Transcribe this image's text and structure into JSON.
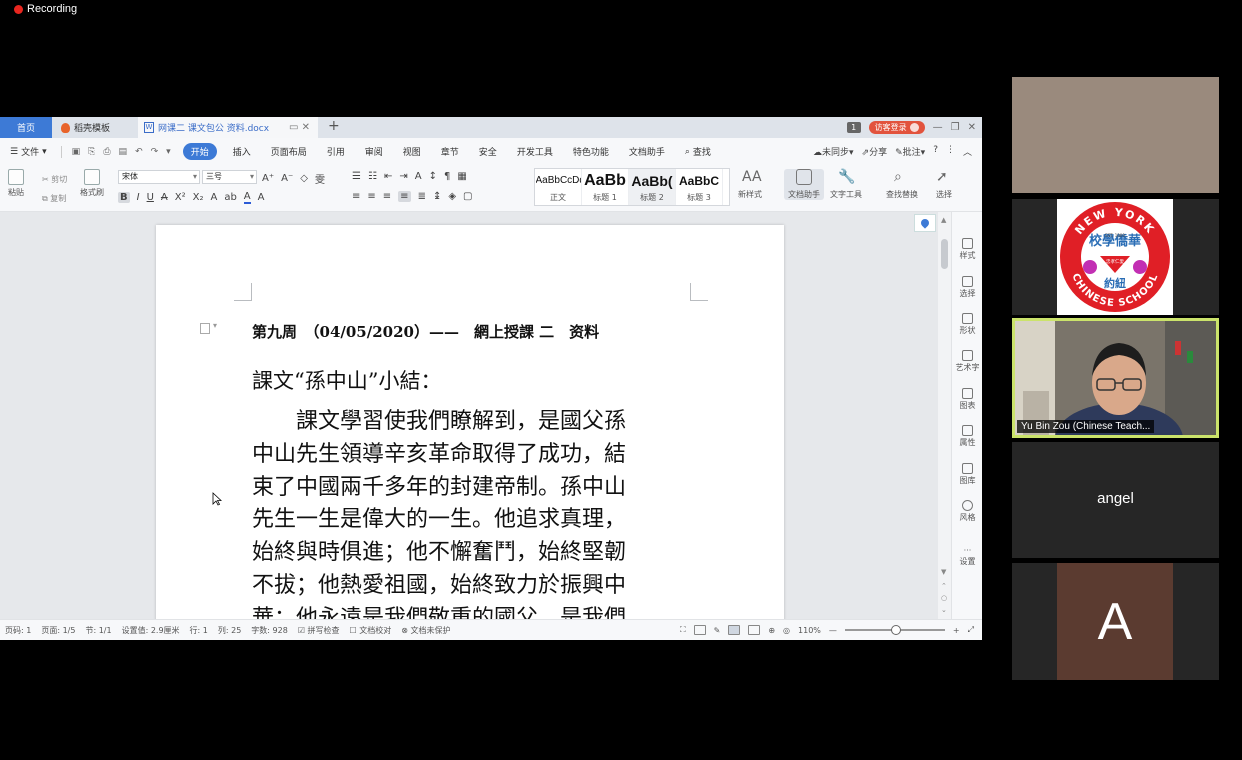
{
  "recording": {
    "label": "Recording"
  },
  "tabs": {
    "home": "首页",
    "template": "稻壳模板",
    "document": "网课二 课文包公 资料.docx"
  },
  "window": {
    "badge": "1",
    "login": "访客登录"
  },
  "menu": {
    "file": "文件",
    "items": [
      "开始",
      "插入",
      "页面布局",
      "引用",
      "审阅",
      "视图",
      "章节",
      "安全",
      "开发工具",
      "特色功能",
      "文档助手"
    ],
    "search": "查找",
    "right": [
      "未同步",
      "分享",
      "批注"
    ],
    "help": "?"
  },
  "ribbon": {
    "paste": "粘贴",
    "cut": "剪切",
    "copy": "复制",
    "format_painter": "格式刷",
    "font_name": "宋体",
    "font_size": "三号",
    "styles": [
      {
        "preview": "AaBbCcDd",
        "label": "正文"
      },
      {
        "preview": "AaBb",
        "label": "标题 1"
      },
      {
        "preview": "AaBb(",
        "label": "标题 2"
      },
      {
        "preview": "AaBbC",
        "label": "标题 3"
      }
    ],
    "new_style": "新样式",
    "doc_assistant": "文档助手",
    "text_tools": "文字工具",
    "find_replace": "查找替换",
    "select": "选择"
  },
  "document": {
    "heading": "第九周　（04/05/2020）——　網上授課 二　资料",
    "subheading": "課文“孫中山”小結：",
    "lines": [
      "　　課文學習使我們瞭解到，是國父孫",
      "中山先生領導辛亥革命取得了成功，結",
      "束了中國兩千多年的封建帝制。孫中山",
      "先生一生是偉大的一生。他追求真理，",
      "始終與時俱進；他不懈奮鬥，始終堅韌",
      "不拔；他熱愛祖國，始終致力於振興中",
      "華；他永遠是我們敬重的國父，是我們"
    ]
  },
  "sidebar": [
    "样式",
    "选择",
    "形状",
    "艺术字",
    "图表",
    "属性",
    "图库",
    "风格",
    "设置"
  ],
  "status": {
    "page_num": "页码: 1",
    "pages": "页面: 1/5",
    "section": "节: 1/1",
    "setting": "设置值: 2.9厘米",
    "row": "行: 1",
    "col": "列: 25",
    "words": "字数: 928",
    "spell": "拼写检查",
    "proof": "文档校对",
    "protect": "文档未保护",
    "zoom": "110%"
  },
  "participants": {
    "teacher_name": "Yu Bin Zou (Chinese Teach...",
    "angel": "angel",
    "avatar_letter": "A",
    "logo_top": "NEW YORK",
    "logo_bottom": "CHINESE SCHOOL",
    "logo_chinese_top": "校學僑華",
    "logo_chinese_bottom": "約紐",
    "logo_center": "忠孝仁愛",
    "logo_est": "EST. 1909"
  },
  "colors": {
    "accent": "#3d7ad6",
    "recording": "#e8261f",
    "speaker_border": "#cbe36b",
    "login": "#e2533d"
  }
}
